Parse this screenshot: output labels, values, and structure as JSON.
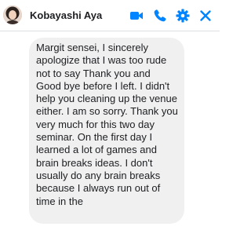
{
  "header": {
    "contact_name": "Kobayashi Aya",
    "icons": {
      "video": "video-camera-icon",
      "phone": "phone-icon",
      "settings": "gear-icon",
      "close": "close-icon"
    }
  },
  "colors": {
    "accent": "#0084ff",
    "bubble_background": "#f1f0f0",
    "text": "#1c1e21"
  },
  "messages": [
    {
      "sender": "Kobayashi Aya",
      "text": "Margit sensei, I sincerely apologize that I was too rude not to say Thank you and Good bye before I left. I didn't help you cleaning up the venue either. I am so sorry. Thank you very much for this two day seminar. On the first day I learned a lot of games and brain breaks ideas. I don't usually do any brain breaks because I always run out of time in the"
    }
  ]
}
